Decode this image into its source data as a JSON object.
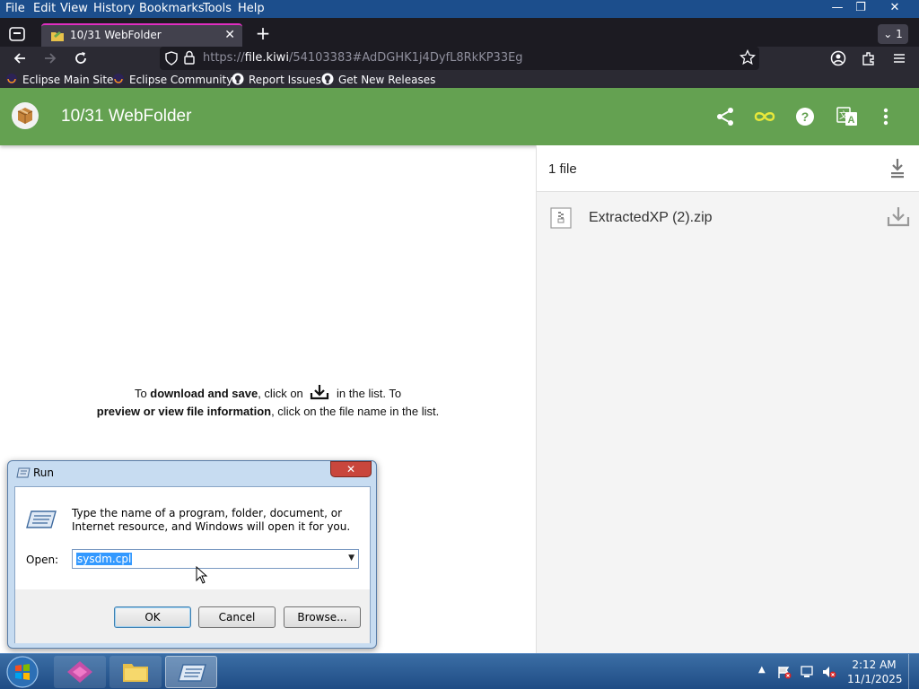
{
  "menubar": {
    "items": [
      "File",
      "Edit",
      "View",
      "History",
      "Bookmarks",
      "Tools",
      "Help"
    ]
  },
  "window_controls": {
    "minimize": "—",
    "restore": "❐",
    "close": "✕"
  },
  "tabs": {
    "active_title": "10/31 WebFolder",
    "tab_count": "1"
  },
  "address": {
    "url_prefix": "https://",
    "url_domain": "file.kiwi",
    "url_rest": "/54103383#AdDGHK1j4DyfL8RkKP33Eg"
  },
  "bookmarks": [
    {
      "label": "Eclipse Main Site",
      "icon": "eclipse-icon"
    },
    {
      "label": "Eclipse Community",
      "icon": "eclipse-icon"
    },
    {
      "label": "Report Issues",
      "icon": "github-icon"
    },
    {
      "label": "Get New Releases",
      "icon": "github-icon"
    }
  ],
  "app": {
    "title": "10/31 WebFolder",
    "header_color": "#64a151"
  },
  "file_list": {
    "count_label": "1 file",
    "files": [
      {
        "name": "ExtractedXP (2).zip"
      }
    ]
  },
  "instructions": {
    "line1_pre": "To ",
    "line1_bold": "download and save",
    "line1_mid": ", click on",
    "line1_post": "in the list. To",
    "line2_bold": "preview or view file information",
    "line2_post": ", click on the file name in the list."
  },
  "run_dialog": {
    "title": "Run",
    "description": "Type the name of a program, folder, document, or Internet resource, and Windows will open it for you.",
    "open_label": "Open:",
    "open_value": "sysdm.cpl",
    "ok_label": "OK",
    "cancel_label": "Cancel",
    "browse_label": "Browse..."
  },
  "taskbar": {
    "time": "2:12 AM",
    "date": "11/1/2025"
  }
}
